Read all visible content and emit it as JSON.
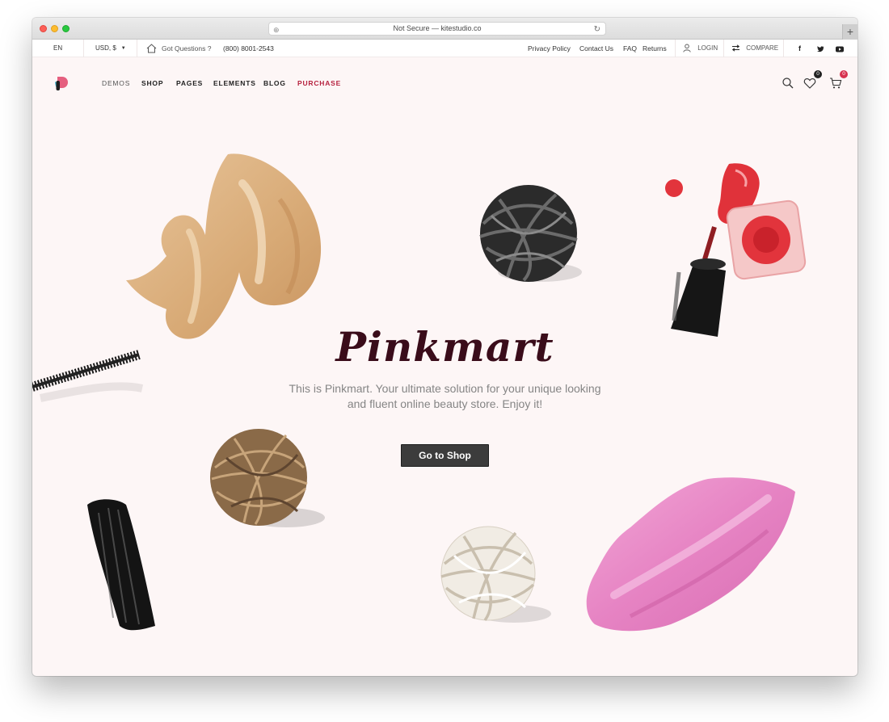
{
  "browser": {
    "address": "Not Secure — kitestudio.co",
    "new_tab": "+"
  },
  "topbar": {
    "language": "EN",
    "currency": "USD, $",
    "questions": "Got Questions ?",
    "phone": "(800) 8001-2543",
    "links": [
      "Privacy Policy",
      "Contact Us",
      "FAQ",
      "Returns"
    ],
    "login": "LOGIN",
    "compare": "COMPARE",
    "social": [
      "f",
      "t",
      "yt"
    ]
  },
  "nav": {
    "items": [
      "DEMOS",
      "SHOP",
      "PAGES",
      "ELEMENTS",
      "BLOG",
      "PURCHASE"
    ],
    "wishlist_count": "0",
    "cart_count": "0"
  },
  "hero": {
    "title": "Pinkmart",
    "subtitle": "This is Pinkmart. Your ultimate solution for your unique looking and fluent online beauty store. Enjoy it!",
    "cta": "Go to Shop"
  },
  "colors": {
    "accent": "#b6223f",
    "hero_bg": "#fdf6f6",
    "button_bg": "#3c3c3c",
    "title": "#3a0c1a"
  }
}
